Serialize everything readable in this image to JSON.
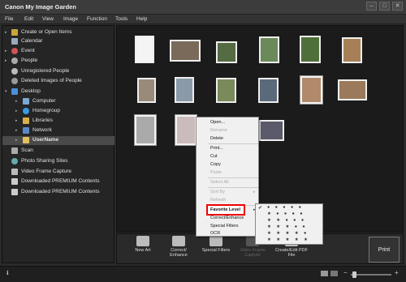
{
  "window": {
    "title": "Canon My Image Garden",
    "minimize": "–",
    "maximize": "□",
    "close": "✕"
  },
  "menu": [
    "File",
    "Edit",
    "View",
    "Image",
    "Function",
    "Tools",
    "Help"
  ],
  "sidebar": {
    "items": [
      {
        "label": "Create or Open Items",
        "icon": "folder-open-icon",
        "arrow": "▸"
      },
      {
        "label": "Calendar",
        "icon": "calendar-icon",
        "arrow": ""
      },
      {
        "label": "Event",
        "icon": "event-icon",
        "arrow": "▸"
      },
      {
        "label": "People",
        "icon": "people-icon",
        "arrow": "▸"
      },
      {
        "label": "Unregistered People",
        "icon": "person-icon",
        "arrow": ""
      },
      {
        "label": "Deleted Images of People",
        "icon": "person-icon",
        "arrow": ""
      },
      {
        "label": "Desktop",
        "icon": "desktop-icon",
        "arrow": "▾"
      },
      {
        "label": "Computer",
        "icon": "computer-icon",
        "arrow": "▸"
      },
      {
        "label": "Homegroup",
        "icon": "homegroup-icon",
        "arrow": "▸"
      },
      {
        "label": "Libraries",
        "icon": "libraries-icon",
        "arrow": "▸"
      },
      {
        "label": "Network",
        "icon": "network-icon",
        "arrow": "▸"
      },
      {
        "label": "UserName",
        "icon": "user-folder-icon",
        "arrow": "▸"
      },
      {
        "label": "Scan",
        "icon": "scan-icon",
        "arrow": ""
      },
      {
        "label": "Photo Sharing Sites",
        "icon": "globe-icon",
        "arrow": ""
      },
      {
        "label": "Video Frame Capture",
        "icon": "video-icon",
        "arrow": ""
      },
      {
        "label": "Downloaded PREMIUM Contents",
        "icon": "download-icon",
        "arrow": ""
      },
      {
        "label": "Downloaded PREMIUM Contents",
        "icon": "download-icon",
        "arrow": ""
      }
    ]
  },
  "context_menu": {
    "items": [
      "Open...",
      "Rename",
      "Delete",
      "Print...",
      "Cut",
      "Copy",
      "Paste",
      "Select All",
      "Sort By",
      "Refresh",
      "Favorite Level",
      "Correct/Enhance",
      "Special Filters",
      "OCR"
    ],
    "disabled": [
      "Rename",
      "Paste",
      "Select All",
      "Sort By",
      "Refresh"
    ],
    "highlighted": "Favorite Level",
    "submenu_arrow": "▸"
  },
  "favorite_submenu": {
    "check": "✔",
    "rows": [
      "● ● ● ● ●",
      "★ ● ● ● ●",
      "★ ★ ● ● ●",
      "★ ★ ★ ● ●",
      "★ ★ ★ ★ ●",
      "★ ★ ★ ★ ★"
    ]
  },
  "toolbar": {
    "buttons": [
      {
        "label": "New Art",
        "enabled": true
      },
      {
        "label": "Correct/ Enhance",
        "enabled": true
      },
      {
        "label": "Special Filters",
        "enabled": true
      },
      {
        "label": "Video Frame Capture",
        "enabled": false
      },
      {
        "label": "Create/Edit PDF File",
        "enabled": true
      }
    ],
    "print": "Print"
  },
  "status": {
    "info": "ℹ",
    "zoom_minus": "−",
    "zoom_plus": "+"
  },
  "colors": {
    "bg": "#2b2b2b",
    "panel": "#1b1b1b",
    "highlight": "#e00000"
  }
}
